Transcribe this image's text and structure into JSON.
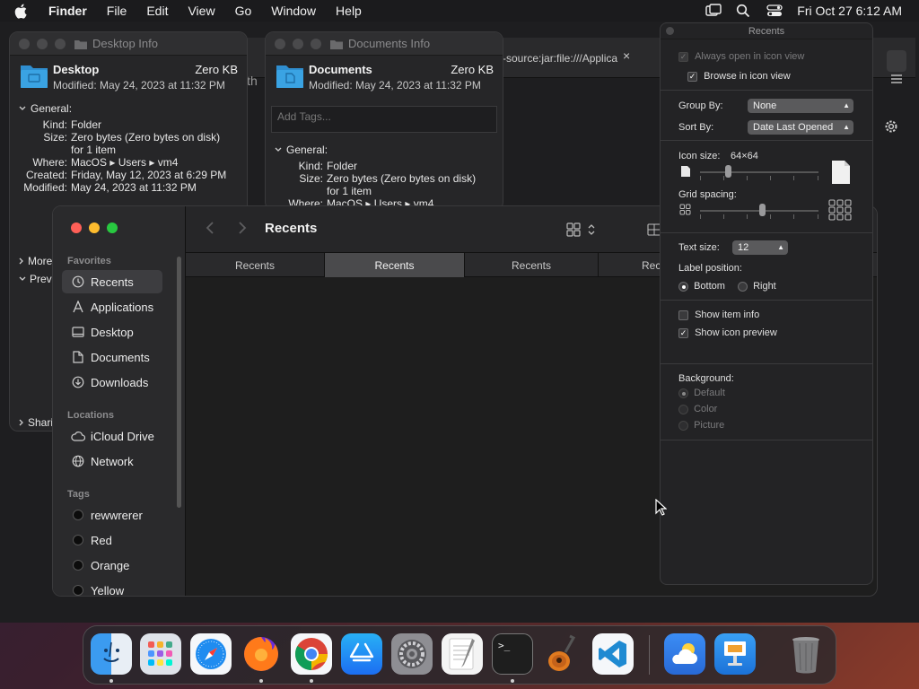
{
  "menubar": {
    "app_name": "Finder",
    "items": [
      "File",
      "Edit",
      "View",
      "Go",
      "Window",
      "Help"
    ],
    "clock": "Fri Oct 27  6:12 AM"
  },
  "background_window": {
    "url_tab": "-source:jar:file:///Applica",
    "close_glyph": "×",
    "partial_text": "ith"
  },
  "desktop_info": {
    "title": "Desktop Info",
    "name": "Desktop",
    "size": "Zero KB",
    "modified_line": "Modified: May 24, 2023 at 11:32 PM",
    "section": "General:",
    "rows": [
      {
        "k": "Kind:",
        "v": "Folder"
      },
      {
        "k": "Size:",
        "v": "Zero bytes (Zero bytes on disk)"
      },
      {
        "k": "",
        "v": "for 1 item"
      },
      {
        "k": "Where:",
        "v": "MacOS ▸ Users ▸ vm4"
      },
      {
        "k": "Created:",
        "v": "Friday, May 12, 2023 at 6:29 PM"
      },
      {
        "k": "Modified:",
        "v": "May 24, 2023 at 11:32 PM"
      }
    ],
    "more": "More",
    "preview": "Previ",
    "sharing": "Shari"
  },
  "documents_info": {
    "title": "Documents Info",
    "name": "Documents",
    "size": "Zero KB",
    "modified_line": "Modified: May 24, 2023 at 11:32 PM",
    "tags_placeholder": "Add Tags...",
    "section": "General:",
    "rows": [
      {
        "k": "Kind:",
        "v": "Folder"
      },
      {
        "k": "Size:",
        "v": "Zero bytes (Zero bytes on disk)"
      },
      {
        "k": "",
        "v": "for 1 item"
      },
      {
        "k": "Where:",
        "v": "MacOS ▸ Users ▸ vm4"
      }
    ]
  },
  "finder": {
    "title": "Recents",
    "sidebar": {
      "favorites_header": "Favorites",
      "favorites": [
        "Recents",
        "Applications",
        "Desktop",
        "Documents",
        "Downloads"
      ],
      "locations_header": "Locations",
      "locations": [
        "iCloud Drive",
        "Network"
      ],
      "tags_header": "Tags",
      "tags": [
        "rewwrerer",
        "Red",
        "Orange",
        "Yellow"
      ]
    },
    "tabs": [
      "Recents",
      "Recents",
      "Recents",
      "Rec"
    ]
  },
  "view_options": {
    "title": "Recents",
    "always_open": "Always open in icon view",
    "browse_icon": "Browse in icon view",
    "group_by_label": "Group By:",
    "group_by_value": "None",
    "sort_by_label": "Sort By:",
    "sort_by_value": "Date Last Opened",
    "icon_size_label": "Icon size:",
    "icon_size_value": "64×64",
    "grid_spacing_label": "Grid spacing:",
    "text_size_label": "Text size:",
    "text_size_value": "12",
    "label_position_label": "Label position:",
    "label_bottom": "Bottom",
    "label_right": "Right",
    "show_item_info": "Show item info",
    "show_icon_preview": "Show icon preview",
    "background_label": "Background:",
    "bg_default": "Default",
    "bg_color": "Color",
    "bg_picture": "Picture",
    "check_glyph": "✓"
  },
  "dock": {
    "apps": [
      "finder",
      "launchpad",
      "safari",
      "firefox",
      "chrome",
      "app-store",
      "system-preferences",
      "textedit",
      "terminal",
      "garageband",
      "vscode",
      "weather",
      "keynote",
      "trash"
    ],
    "terminal_glyph": ">_"
  },
  "colors": {
    "close": "#ff5f57",
    "minimize": "#febc2e",
    "zoom": "#28c840",
    "folder": "#3aa3e3",
    "accent": "#0a84ff"
  }
}
